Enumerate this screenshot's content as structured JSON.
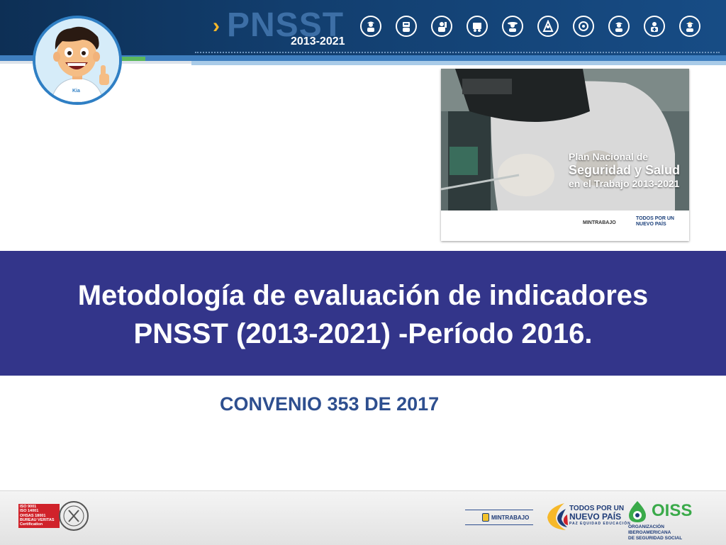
{
  "header": {
    "brand": "PNSST",
    "years": "2013-2021",
    "icons": [
      "construction-worker-icon",
      "welder-icon",
      "mechanic-icon",
      "machinery-icon",
      "farmer-icon",
      "mining-icon",
      "driver-icon",
      "engineer-icon",
      "health-worker-icon",
      "miner-icon"
    ]
  },
  "cover": {
    "line1": "Plan Nacional de",
    "line2": "Seguridad y Salud",
    "line3": "en el Trabajo 2013-2021",
    "ministry": "MINTRABAJO",
    "slogan": "TODOS POR UN NUEVO PAÍS"
  },
  "title": {
    "line1": "Metodología de evaluación de indicadores",
    "line2": "PNSST (2013-2021) -Período 2016."
  },
  "subtitle": "CONVENIO 353 DE 2017",
  "footer": {
    "iso_lines": [
      "ISO 9001",
      "ISO 14001",
      "OHSAS 18001",
      "BUREAU VERITAS",
      "Certification"
    ],
    "ministry": "MINTRABAJO",
    "todos_l1": "TODOS POR UN",
    "todos_l2": "NUEVO PAÍS",
    "todos_l3": "PAZ  EQUIDAD  EDUCACIÓN",
    "oiss": "OISS",
    "oiss_sub1": "ORGANIZACIÓN IBEROAMERICANA",
    "oiss_sub2": "DE SEGURIDAD SOCIAL"
  },
  "colors": {
    "header_bg": "#123e6e",
    "title_band": "#33358a",
    "subtitle": "#2e4f8f",
    "accent_yellow": "#f6b82a",
    "oiss_green": "#3aaa4a"
  }
}
